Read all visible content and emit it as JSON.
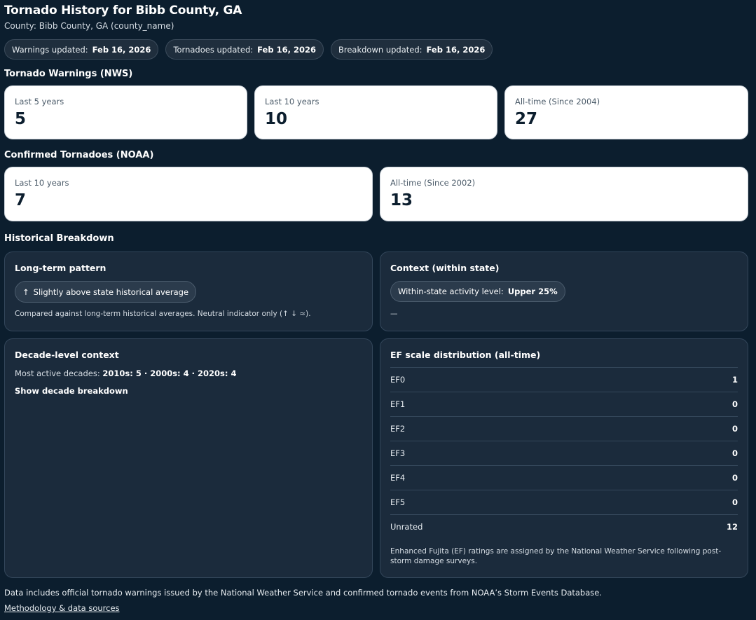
{
  "header": {
    "title": "Tornado History for Bibb County, GA",
    "subtitle": "County: Bibb County, GA (county_name)"
  },
  "updates": [
    {
      "label": "Warnings updated:",
      "value": "Feb 16, 2026"
    },
    {
      "label": "Tornadoes updated:",
      "value": "Feb 16, 2026"
    },
    {
      "label": "Breakdown updated:",
      "value": "Feb 16, 2026"
    }
  ],
  "warnings": {
    "heading": "Tornado Warnings (NWS)",
    "cards": [
      {
        "label": "Last 5 years",
        "value": "5"
      },
      {
        "label": "Last 10 years",
        "value": "10"
      },
      {
        "label": "All-time (Since 2004)",
        "value": "27"
      }
    ]
  },
  "tornadoes": {
    "heading": "Confirmed Tornadoes (NOAA)",
    "cards": [
      {
        "label": "Last 10 years",
        "value": "7"
      },
      {
        "label": "All-time (Since 2002)",
        "value": "13"
      }
    ]
  },
  "breakdown": {
    "heading": "Historical Breakdown",
    "pattern": {
      "title": "Long-term pattern",
      "arrow": "↑",
      "chip": "Slightly above state historical average",
      "note": "Compared against long-term historical averages. Neutral indicator only (↑ ↓ ≈)."
    },
    "context": {
      "title": "Context (within state)",
      "chip_label": "Within-state activity level:",
      "chip_value": "Upper 25%",
      "dash": "—"
    },
    "decades": {
      "title": "Decade-level context",
      "prefix": "Most active decades:",
      "values": "2010s: 5 · 2000s: 4 · 2020s: 4",
      "link": "Show decade breakdown"
    },
    "ef": {
      "title": "EF scale distribution (all-time)",
      "rows": [
        {
          "label": "EF0",
          "value": "1"
        },
        {
          "label": "EF1",
          "value": "0"
        },
        {
          "label": "EF2",
          "value": "0"
        },
        {
          "label": "EF3",
          "value": "0"
        },
        {
          "label": "EF4",
          "value": "0"
        },
        {
          "label": "EF5",
          "value": "0"
        },
        {
          "label": "Unrated",
          "value": "12"
        }
      ],
      "note": "Enhanced Fujita (EF) ratings are assigned by the National Weather Service following post-storm damage surveys."
    }
  },
  "footer": {
    "text": "Data includes official tornado warnings issued by the National Weather Service and confirmed tornado events from NOAA’s Storm Events Database.",
    "link": "Methodology & data sources"
  }
}
